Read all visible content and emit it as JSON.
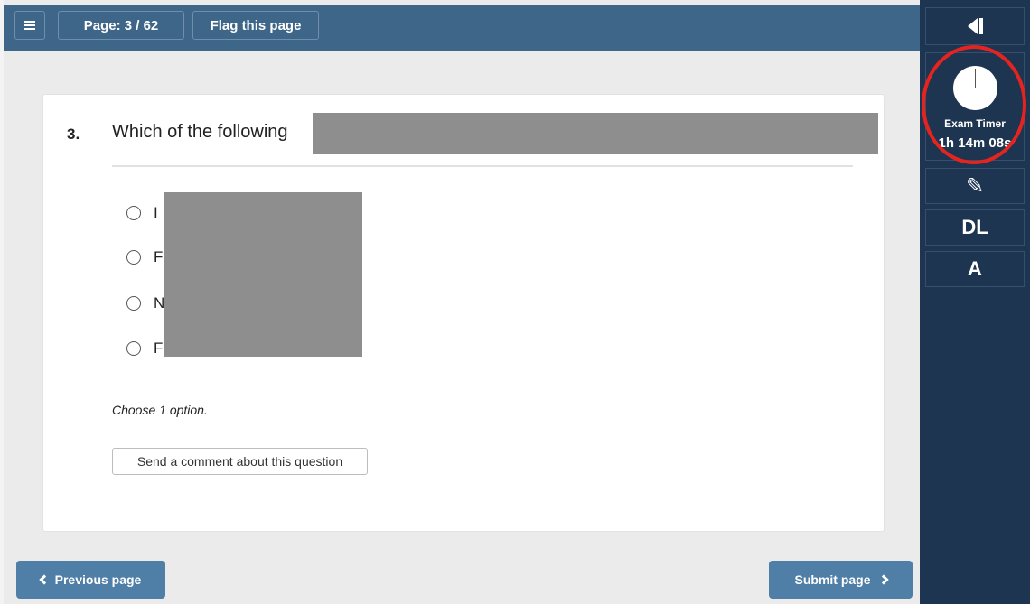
{
  "header": {
    "page_indicator": "Page: 3 / 62",
    "flag_label": "Flag this page"
  },
  "question": {
    "number": "3.",
    "text": "Which of the following",
    "options": [
      {
        "label": "I"
      },
      {
        "label": "F"
      },
      {
        "label": "N"
      },
      {
        "label": "F"
      }
    ],
    "hint": "Choose 1 option.",
    "comment_button": "Send a comment about this question"
  },
  "navigation": {
    "previous_label": "Previous page",
    "submit_label": "Submit page"
  },
  "sidebar": {
    "timer_label": "Exam Timer",
    "timer_value": "1h 14m 08s",
    "pencil_glyph": "✎",
    "dl_label": "DL",
    "a_label": "A"
  },
  "colors": {
    "topbar": "#3e6688",
    "sidebar": "#1d3550",
    "nav_button": "#4f7ea6",
    "highlight_circle": "#e5231f",
    "redaction": "#8e8e8e"
  },
  "icons": [
    "menu-icon",
    "chevron-left-icon",
    "chevron-right-icon",
    "collapse-icon",
    "clock-icon",
    "pencil-icon"
  ]
}
